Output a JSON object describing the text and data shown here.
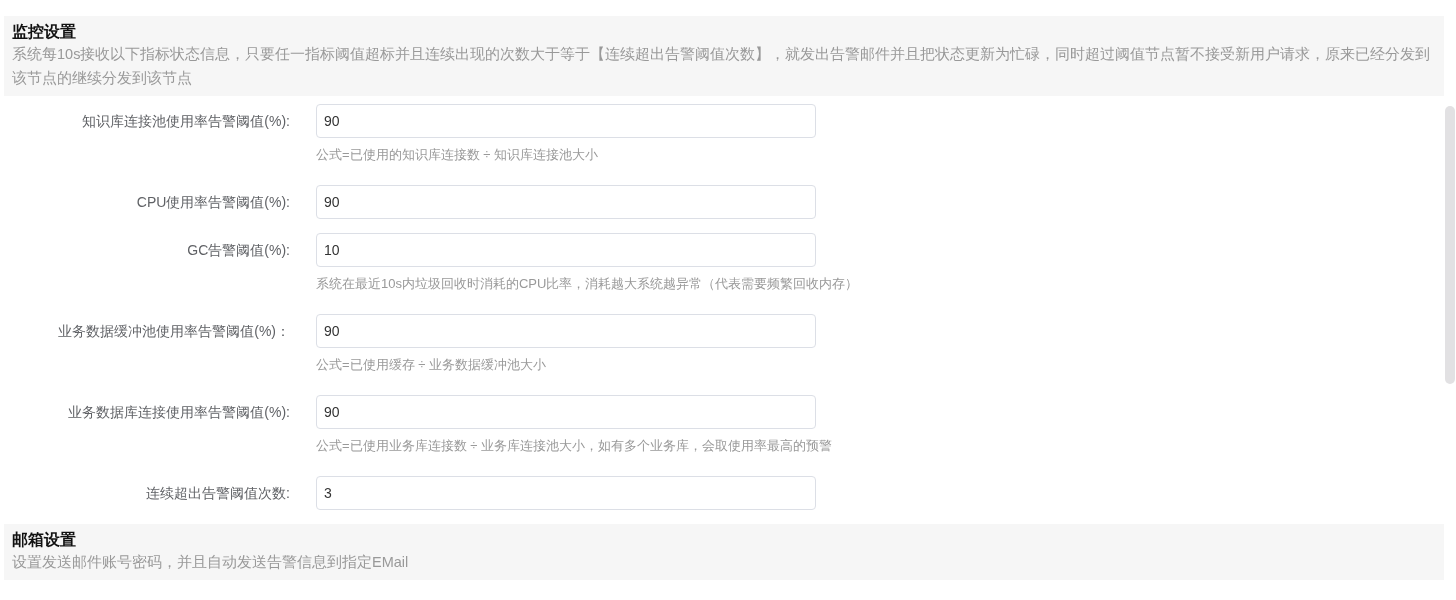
{
  "sections": [
    {
      "title": "监控设置",
      "description": "系统每10s接收以下指标状态信息，只要任一指标阈值超标并且连续出现的次数大于等于【连续超出告警阈值次数】，就发出告警邮件并且把状态更新为忙碌，同时超过阈值节点暂不接受新用户请求，原来已经分发到该节点的继续分发到该节点",
      "fields": [
        {
          "label": "知识库连接池使用率告警阈值(%):",
          "value": "90",
          "hint": "公式=已使用的知识库连接数 ÷ 知识库连接池大小"
        },
        {
          "label": "CPU使用率告警阈值(%):",
          "value": "90"
        },
        {
          "label": "GC告警阈值(%):",
          "value": "10",
          "hint": "系统在最近10s内垃圾回收时消耗的CPU比率，消耗越大系统越异常（代表需要频繁回收内存）"
        },
        {
          "label": "业务数据缓冲池使用率告警阈值(%)：",
          "value": "90",
          "hint": "公式=已使用缓存 ÷ 业务数据缓冲池大小"
        },
        {
          "label": "业务数据库连接使用率告警阈值(%):",
          "value": "90",
          "hint": "公式=已使用业务库连接数 ÷ 业务库连接池大小，如有多个业务库，会取使用率最高的预警"
        },
        {
          "label": "连续超出告警阈值次数:",
          "value": "3"
        }
      ]
    },
    {
      "title": "邮箱设置",
      "description": "设置发送邮件账号密码，并且自动发送告警信息到指定EMail"
    }
  ]
}
